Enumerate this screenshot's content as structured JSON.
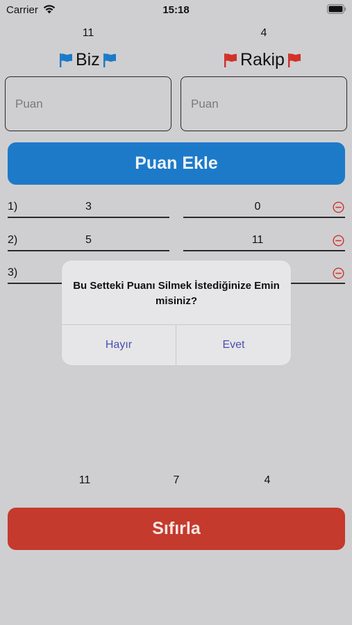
{
  "status_bar": {
    "carrier": "Carrier",
    "time": "15:18"
  },
  "teams": {
    "us": {
      "score": "11",
      "name": "Biz",
      "flag_color": "#1d7ac8"
    },
    "them": {
      "score": "4",
      "name": "Rakip",
      "flag_color": "#d0312b"
    }
  },
  "inputs": {
    "us_placeholder": "Puan",
    "them_placeholder": "Puan"
  },
  "add_button_label": "Puan Ekle",
  "rounds": [
    {
      "index": "1)",
      "us": "3",
      "them": "0"
    },
    {
      "index": "2)",
      "us": "5",
      "them": "11"
    },
    {
      "index": "3)",
      "us": "",
      "them": ""
    }
  ],
  "totals": {
    "us": "11",
    "diff": "7",
    "them": "4"
  },
  "reset_button_label": "Sıfırla",
  "alert": {
    "message": "Bu Setteki Puanı Silmek İstediğinize Emin misiniz?",
    "cancel_label": "Hayır",
    "confirm_label": "Evet"
  },
  "colors": {
    "accent_blue": "#1d7ac8",
    "accent_red": "#c43a2d",
    "delete_icon": "#d0312b",
    "alert_action": "#4a4eb0"
  }
}
